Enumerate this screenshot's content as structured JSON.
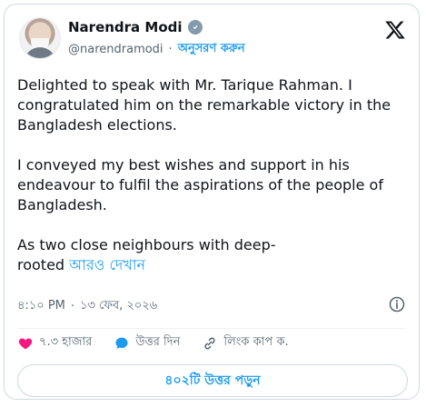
{
  "author": {
    "name": "Narendra Modi",
    "handle": "@narendramodi",
    "follow_label": "অনুসরণ করুন"
  },
  "tweet": {
    "text": "Delighted to speak with Mr. Tarique Rahman. I congratulated him on the remarkable victory in the Bangladesh elections.\n\nI conveyed my best wishes and support in his endeavour to fulfil the aspirations of the people of Bangladesh.\n\nAs two close neighbours with deep-\nrooted ",
    "show_more_label": "আরও দেখান"
  },
  "meta": {
    "time": "৪:১০ PM",
    "separator": "·",
    "date": "১৩ ফেব, ২০২৬"
  },
  "actions": {
    "likes_count": "৭.৩ হাজার",
    "reply_label": "উত্তর দিন",
    "copy_link_label": "লিংক কাপ ক."
  },
  "read_replies": {
    "label": "৪০২টি উত্তর পড়ুন"
  },
  "colors": {
    "accent": "#1d9bf0",
    "like_red": "#f91880",
    "text_primary": "#0f1419",
    "text_secondary": "#536471",
    "border": "#cfd9de"
  },
  "icons": {
    "verified": "verified-badge-icon",
    "x_logo": "x-logo-icon",
    "info": "info-icon",
    "like": "heart-icon",
    "reply": "reply-bubble-icon",
    "link": "link-icon"
  }
}
